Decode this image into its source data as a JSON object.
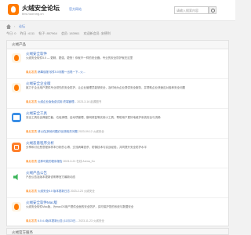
{
  "header": {
    "site_title": "火绒安全论坛",
    "site_url": "bbs.huorong.cn",
    "official_link": "官方网站",
    "search_placeholder": "请输入搜索内容"
  },
  "breadcrumb": {
    "current": "论坛"
  },
  "stats": {
    "today": "今日: 0",
    "yesterday": "昨日: 4111",
    "posts": "帖子: 857964",
    "members": "会员: 183961",
    "newest": "欢迎新会员: 安德利"
  },
  "section": {
    "title": "火绒产品",
    "bottom_title": "火绒官方服务"
  },
  "forums": [
    {
      "icon": "fire-icon",
      "title": "火绒安全软件",
      "desc": "火绒安全软件5.0 — 更精、更强、更快！你就不一样的安全器。专业的安全防护就在这里",
      "tag": "最后发表",
      "link": "病毒误报 软件5.0问题一出现一下...火...",
      "time": ""
    },
    {
      "icon": "fire-icon",
      "title": "火绒安全企业版",
      "desc": "致力于企业用户提供专业领先的安全防护，让企业管理员能够安全，及时地为企业提供安全服务，并帮助企业快速应对各种安全问题",
      "tag": "最后发表",
      "link": "火绒企业版免费试用 终端管理...",
      "time": "2023-3-16 起源图书"
    },
    {
      "icon": "mail-icon",
      "title": "火绒安全工具",
      "desc": "安全工具包含弹窗拦截、垃圾清理、启动项管理、断网修复等实用小工具，帮助用户更好地维护系统安全与流畅",
      "tag": "最后发表",
      "link": "请以在[其他问题]中反馈相关问题",
      "time": "2023-09-12 火绒安全"
    },
    {
      "icon": "square-icon",
      "title": "火绒恶意程序分析",
      "desc": "分享和讨论恶意程序样本分析的心得，交流病毒查杀、防御技术与实战经验，共同提升安全防护水平",
      "tag": "最后发表",
      "link": "这种可能的程序报告",
      "time": "2023-3-21 在线 Arena_Ko"
    },
    {
      "icon": "speaker-icon",
      "title": "火绒产品公告",
      "desc": "产品公告及版本更新说明等官方最新动态",
      "tag": "最后发表",
      "link": "火绒安全5.0 版本更新日志",
      "time": "2023-2-23 火绒安全"
    },
    {
      "icon": "fire-icon",
      "title": "火绒安全软件Mac版",
      "desc": "火绒安全软件Mac版，为macOS用户提供全面的安全防护，实时保护您的系统与数据安全",
      "tag": "最后发表",
      "link": "6.0.4.4版本更新公告 (11月23日...",
      "time": "2023-11-23 火绒安全"
    }
  ]
}
